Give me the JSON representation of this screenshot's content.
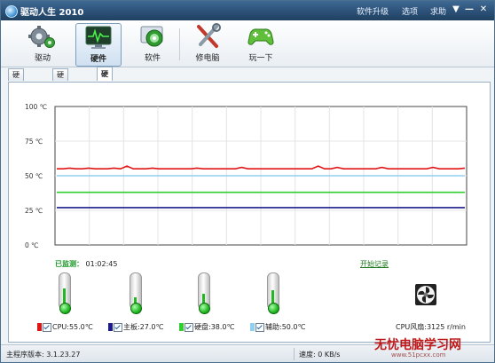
{
  "window": {
    "title": "驱动人生 2010",
    "menu": [
      "软件升级",
      "选项",
      "求助"
    ],
    "controls": [
      "▼",
      "—",
      "✕"
    ]
  },
  "toolbar": {
    "items": [
      {
        "label": "驱动",
        "icon": "gear-icon",
        "active": false
      },
      {
        "label": "硬件",
        "icon": "monitor-pulse-icon",
        "active": true
      },
      {
        "label": "软件",
        "icon": "disc-icon",
        "active": false
      },
      {
        "label": "修电脑",
        "icon": "tools-icon",
        "active": false
      },
      {
        "label": "玩一下",
        "icon": "gamepad-icon",
        "active": false
      }
    ]
  },
  "tabs": [
    {
      "label": "硬件概述",
      "active": false
    },
    {
      "label": "硬件信息",
      "active": false
    },
    {
      "label": "硬件温度",
      "active": true
    }
  ],
  "chart_data": {
    "type": "line",
    "y_ticks": [
      "100 ℃",
      "75 ℃",
      "50 ℃",
      "25 ℃",
      "0 ℃"
    ],
    "ylim": [
      0,
      100
    ],
    "grid": true,
    "series": [
      {
        "name": "CPU",
        "color": "#e01515",
        "values": [
          55,
          55,
          55.5,
          55,
          55,
          55.5,
          55,
          55,
          55,
          55.5,
          55,
          57,
          55,
          55,
          55,
          55.5,
          55,
          55,
          55,
          55,
          55,
          55,
          55.5,
          55,
          55,
          55,
          55,
          55,
          55,
          56,
          55,
          55,
          55,
          55,
          55,
          55,
          55,
          55,
          55,
          55,
          55,
          57,
          55,
          55,
          56,
          55,
          55,
          55,
          55,
          55,
          55,
          56,
          55,
          55,
          55,
          55,
          55,
          55,
          55,
          56,
          55,
          55,
          55,
          55,
          55.5
        ]
      },
      {
        "name": "主板",
        "color": "#1c1c8c",
        "values": [
          27,
          27,
          27,
          27,
          27,
          27,
          27,
          27,
          27,
          27,
          27,
          27,
          27,
          27,
          27,
          27,
          27,
          27,
          27,
          27,
          27,
          27,
          27,
          27,
          27,
          27,
          27,
          27,
          27,
          27,
          27,
          27,
          27,
          27,
          27,
          27,
          27,
          27,
          27,
          27,
          27,
          27,
          27,
          27,
          27,
          27,
          27,
          27,
          27,
          27,
          27,
          27,
          27,
          27,
          27,
          27,
          27,
          27,
          27,
          27,
          27,
          27,
          27,
          27,
          27
        ]
      },
      {
        "name": "硬盘",
        "color": "#2fcf2f",
        "values": [
          38,
          38,
          38,
          38,
          38,
          38,
          38,
          38,
          38,
          38,
          38,
          38,
          38,
          38,
          38,
          38,
          38,
          38,
          38,
          38,
          38,
          38,
          38,
          38,
          38,
          38,
          38,
          38,
          38,
          38,
          38,
          38,
          38,
          38,
          38,
          38,
          38,
          38,
          38,
          38,
          38,
          38,
          38,
          38,
          38,
          38,
          38,
          38,
          38,
          38,
          38,
          38,
          38,
          38,
          38,
          38,
          38,
          38,
          38,
          38,
          38,
          38,
          38,
          38,
          38
        ]
      },
      {
        "name": "辅助",
        "color": "#8fd0f0",
        "values": [
          50,
          50,
          50,
          50,
          50,
          50,
          50,
          50,
          50,
          50,
          50,
          50,
          50,
          50,
          50,
          50,
          50,
          50,
          50,
          50,
          50,
          50,
          50,
          50,
          50,
          50,
          50,
          50,
          50,
          50,
          50,
          50,
          50,
          50,
          50,
          50,
          50,
          50,
          50,
          50,
          50,
          50,
          50,
          50,
          50,
          50,
          50,
          50,
          50,
          50,
          50,
          50,
          50,
          50,
          50,
          50,
          50,
          50,
          50,
          50,
          50,
          50,
          50,
          50,
          50
        ]
      }
    ]
  },
  "monitor": {
    "label": "已监测：",
    "time": "01:02:45",
    "start_record": "开始记录"
  },
  "thermometers": [
    {
      "name": "cpu",
      "level_percent": 55
    },
    {
      "name": "mainboard",
      "level_percent": 27
    },
    {
      "name": "disk",
      "level_percent": 38
    },
    {
      "name": "aux",
      "level_percent": 50
    }
  ],
  "legend": [
    {
      "text": "CPU:55.0℃",
      "color": "#e01515"
    },
    {
      "text": "主板:27.0℃",
      "color": "#1c1c8c"
    },
    {
      "text": "硬盘:38.0℃",
      "color": "#2fcf2f"
    },
    {
      "text": "辅助:50.0℃",
      "color": "#8fd0f0"
    }
  ],
  "fan": {
    "text": "CPU风扇:3125 r/min",
    "icon": "fan-icon"
  },
  "status": {
    "version": "主程序版本: 3.1.23.27",
    "speed": "速度:  0 KB/s"
  },
  "watermark": {
    "text": "无忧电脑学习网",
    "url": "www.51pcxx.com"
  }
}
